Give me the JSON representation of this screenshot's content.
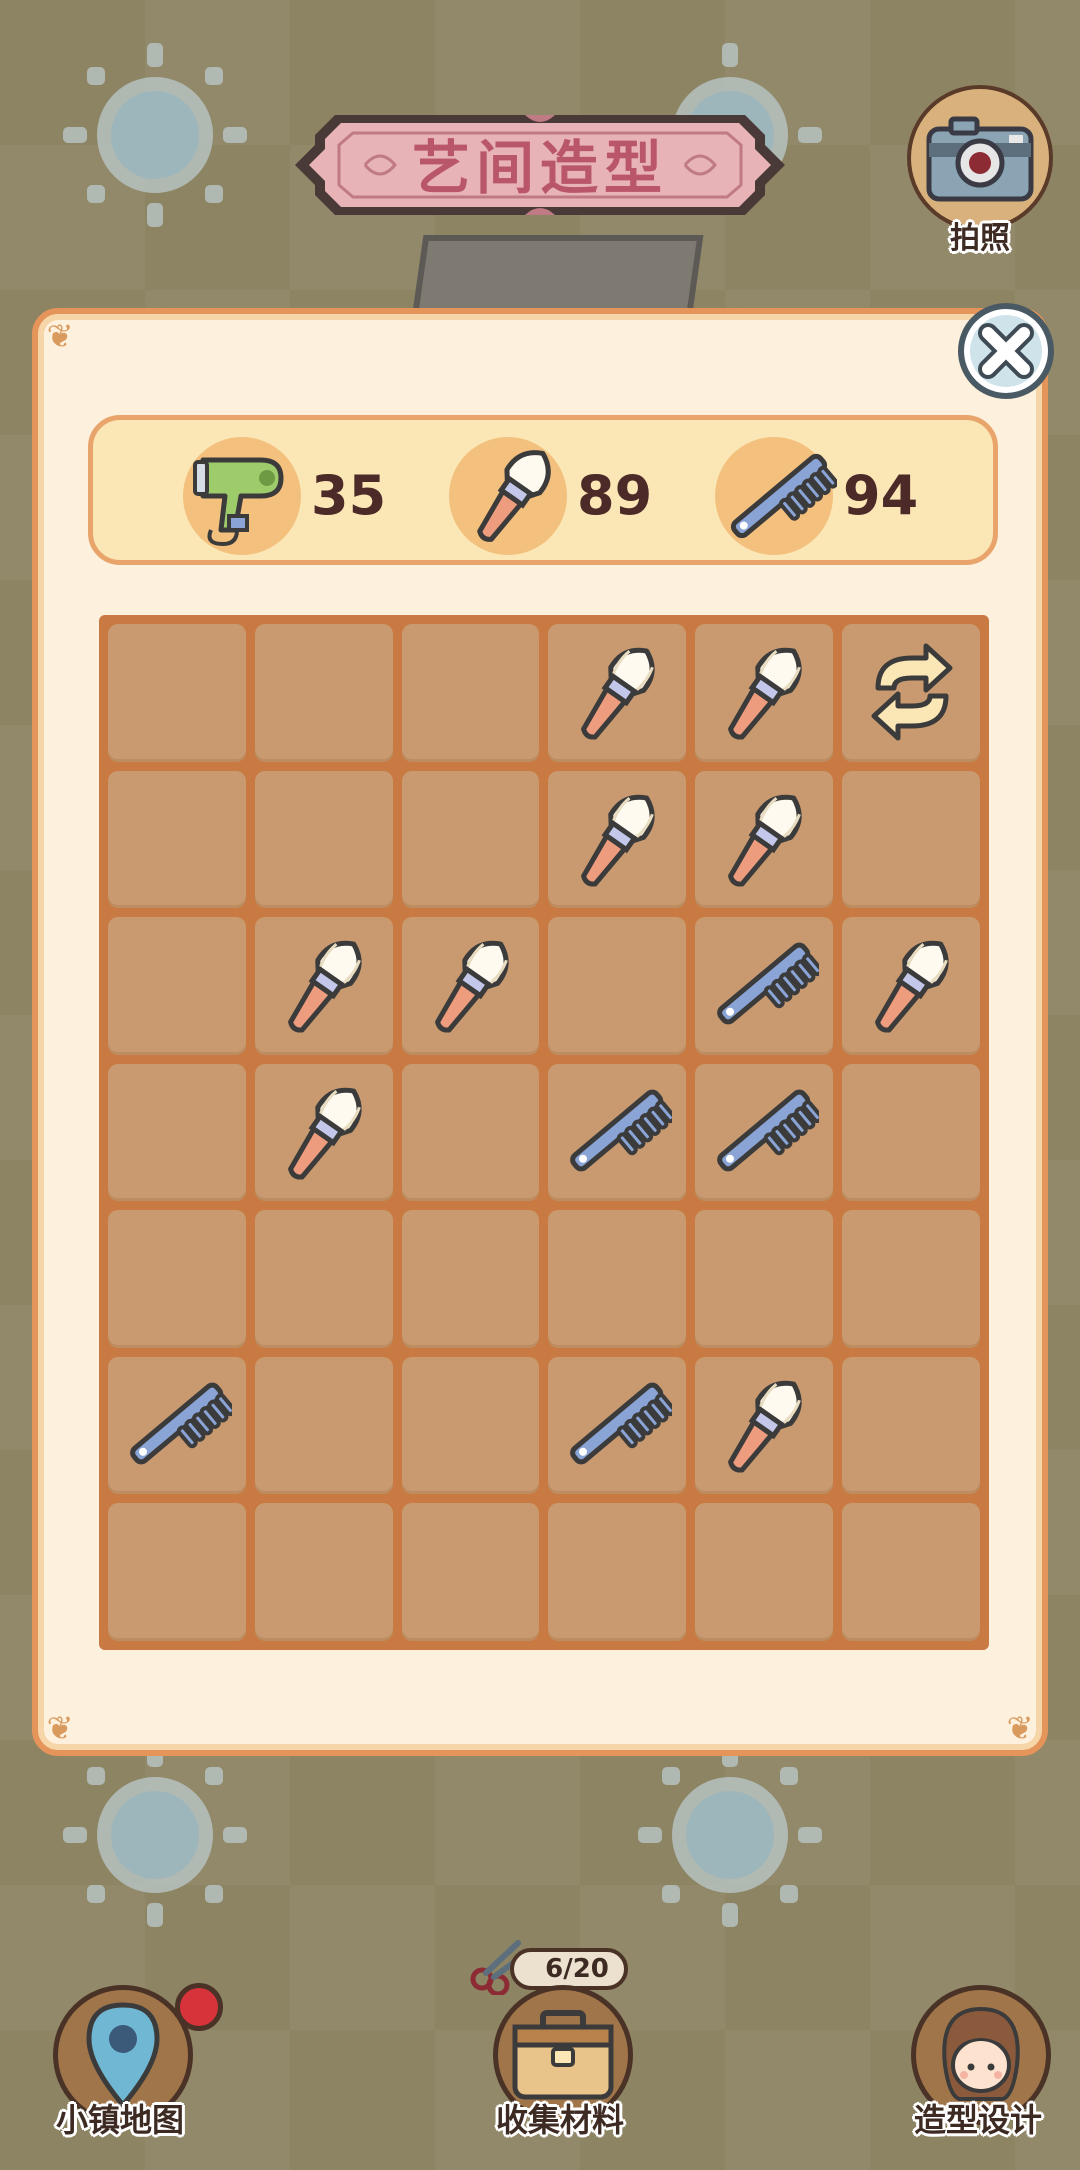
{
  "header": {
    "title": "艺间造型"
  },
  "camera": {
    "label": "拍照",
    "icon": "camera-icon"
  },
  "resources": [
    {
      "name": "hair-dryer",
      "icon": "hair-dryer-icon",
      "count": "35",
      "color": "#8fc06a"
    },
    {
      "name": "makeup-brush",
      "icon": "makeup-brush-icon",
      "count": "89",
      "color": "#ee9c7e"
    },
    {
      "name": "comb",
      "icon": "comb-icon",
      "count": "94",
      "color": "#8aa4d6"
    }
  ],
  "board": {
    "rows": 7,
    "cols": 6,
    "cells": [
      [
        "",
        "",
        "",
        "brush",
        "brush",
        "refresh"
      ],
      [
        "",
        "",
        "",
        "brush",
        "brush",
        ""
      ],
      [
        "",
        "brush",
        "brush",
        "",
        "comb",
        "brush"
      ],
      [
        "",
        "brush",
        "",
        "comb",
        "comb",
        ""
      ],
      [
        "",
        "",
        "",
        "",
        "",
        ""
      ],
      [
        "comb",
        "",
        "",
        "comb",
        "brush",
        ""
      ],
      [
        "",
        "",
        "",
        "",
        "",
        ""
      ]
    ]
  },
  "nav": {
    "map": {
      "label": "小镇地图",
      "icon": "map-pin-icon",
      "has_notification": true
    },
    "collect": {
      "label": "收集材料",
      "icon": "suitcase-icon",
      "progress": "6/20"
    },
    "design": {
      "label": "造型设计",
      "icon": "avatar-icon"
    }
  },
  "colors": {
    "panel": "#fdf0dc",
    "grid": "#c97a42",
    "cell": "#c99a6f",
    "title": "#b9566a"
  }
}
